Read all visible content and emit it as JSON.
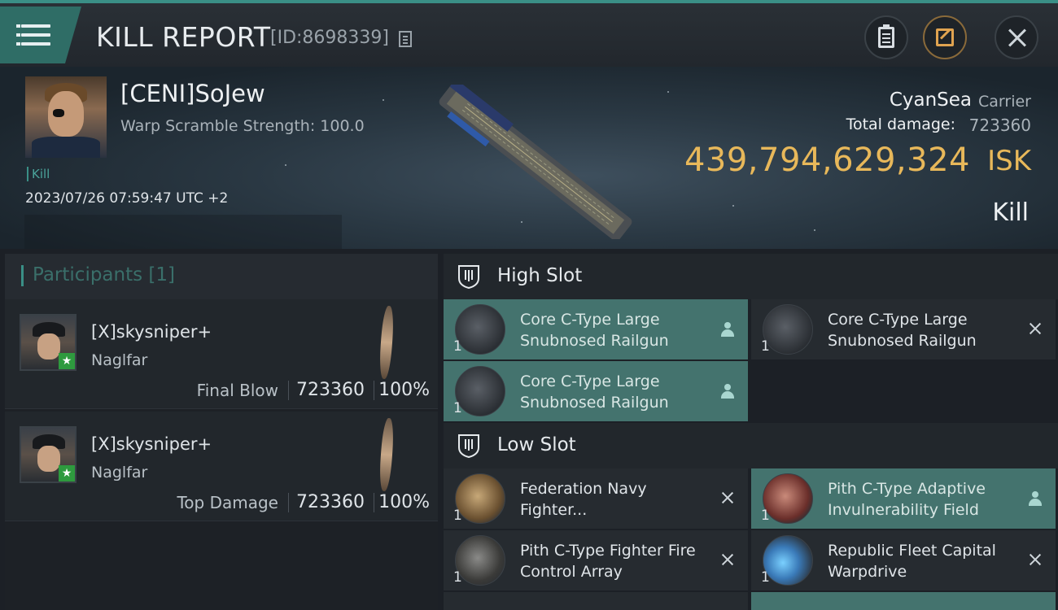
{
  "header": {
    "title": "KILL REPORT",
    "report_id": "[ID:8698339]",
    "icons": {
      "menu": "hamburger-menu-icon",
      "copy": "copy-icon",
      "clipboard": "clipboard-icon",
      "share": "share-icon",
      "close": "close-icon"
    }
  },
  "victim": {
    "name": "[CENI]SoJew",
    "warp_scramble": "Warp Scramble Strength: 100.0",
    "kill_tag": "Kill",
    "timestamp": "2023/07/26 07:59:47 UTC +2",
    "ship_name": "CyanSea",
    "ship_class": "Carrier",
    "total_damage_label": "Total damage:",
    "total_damage_value": "723360",
    "isk_value": "439,794,629,324",
    "isk_unit": "ISK",
    "result_label": "Kill"
  },
  "participants": {
    "title": "Participants [1]",
    "rows": [
      {
        "name": "[X]skysniper+",
        "ship": "Naglfar",
        "role": "Final Blow",
        "damage": "723360",
        "percent": "100%"
      },
      {
        "name": "[X]skysniper+",
        "ship": "Naglfar",
        "role": "Top Damage",
        "damage": "723360",
        "percent": "100%"
      }
    ]
  },
  "high_slot": {
    "title": "High Slot",
    "modules": [
      {
        "name": "Core C-Type Large Snubnosed Railgun",
        "qty": "1",
        "status": "dropped"
      },
      {
        "name": "Core C-Type Large Snubnosed Railgun",
        "qty": "1",
        "status": "destroyed"
      },
      {
        "name": "Core C-Type Large Snubnosed Railgun",
        "qty": "1",
        "status": "dropped"
      }
    ]
  },
  "low_slot": {
    "title": "Low Slot",
    "modules": [
      {
        "name": "Federation Navy Fighter...",
        "qty": "1",
        "status": "destroyed"
      },
      {
        "name": "Pith C-Type Adaptive Invulnerability Field",
        "qty": "1",
        "status": "dropped"
      },
      {
        "name": "Pith C-Type Fighter Fire Control Array",
        "qty": "1",
        "status": "destroyed"
      },
      {
        "name": "Republic Fleet Capital Warpdrive",
        "qty": "1",
        "status": "destroyed"
      }
    ]
  },
  "colors": {
    "accent": "#3a8f86",
    "isk": "#e8b85a",
    "dropped_bg": "#44736e",
    "panel": "#22272c"
  }
}
